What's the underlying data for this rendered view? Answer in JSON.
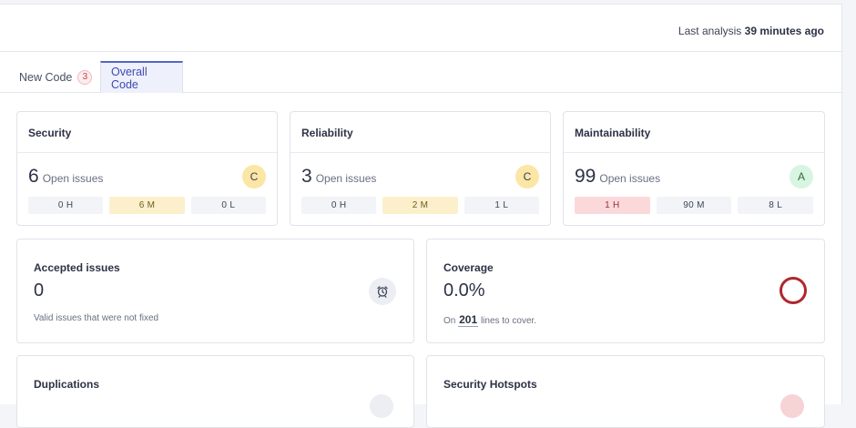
{
  "header": {
    "last_analysis_prefix": "Last analysis",
    "last_analysis_time": "39 minutes ago"
  },
  "tabs": {
    "new_code": {
      "label": "New Code",
      "count": "3"
    },
    "overall_code": {
      "label": "Overall Code",
      "active": true
    }
  },
  "security": {
    "title": "Security",
    "count": "6",
    "open_label": "Open issues",
    "rating": "C",
    "high": "0 H",
    "medium": "6 M",
    "low": "0 L"
  },
  "reliability": {
    "title": "Reliability",
    "count": "3",
    "open_label": "Open issues",
    "rating": "C",
    "high": "0 H",
    "medium": "2 M",
    "low": "1 L"
  },
  "maintainability": {
    "title": "Maintainability",
    "count": "99",
    "open_label": "Open issues",
    "rating": "A",
    "high": "1 H",
    "medium": "90 M",
    "low": "8 L"
  },
  "accepted": {
    "title": "Accepted issues",
    "value": "0",
    "subtitle": "Valid issues that were not fixed",
    "icon": "alarm-clock-icon"
  },
  "coverage": {
    "title": "Coverage",
    "value": "0.0%",
    "sub_prefix": "On",
    "lines": "201",
    "sub_suffix": "lines to cover.",
    "icon": "coverage-ring-icon",
    "ring_color": "#b0272c"
  },
  "duplications": {
    "title": "Duplications"
  },
  "hotspots": {
    "title": "Security Hotspots"
  },
  "colors": {
    "accent": "#5764c6",
    "rating_c": "#fbe6a6",
    "rating_a": "#d7f5e1",
    "severity_medium": "#fcf0cc",
    "severity_high": "#fbd9db"
  }
}
